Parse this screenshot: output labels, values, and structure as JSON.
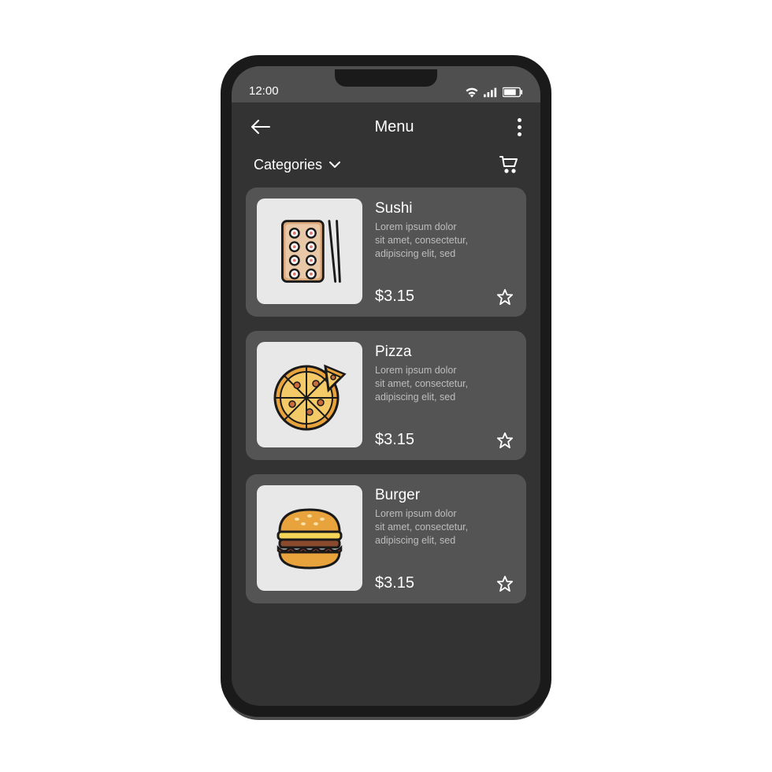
{
  "status": {
    "time": "12:00"
  },
  "header": {
    "title": "Menu"
  },
  "filter": {
    "label": "Categories"
  },
  "items": [
    {
      "title": "Sushi",
      "desc": "Lorem ipsum dolor\nsit amet, consectetur,\nadipiscing elit, sed",
      "price": "$3.15",
      "icon": "sushi"
    },
    {
      "title": "Pizza",
      "desc": "Lorem ipsum dolor\nsit amet, consectetur,\nadipiscing elit, sed",
      "price": "$3.15",
      "icon": "pizza"
    },
    {
      "title": "Burger",
      "desc": "Lorem ipsum dolor\nsit amet, consectetur,\nadipiscing elit, sed",
      "price": "$3.15",
      "icon": "burger"
    }
  ]
}
